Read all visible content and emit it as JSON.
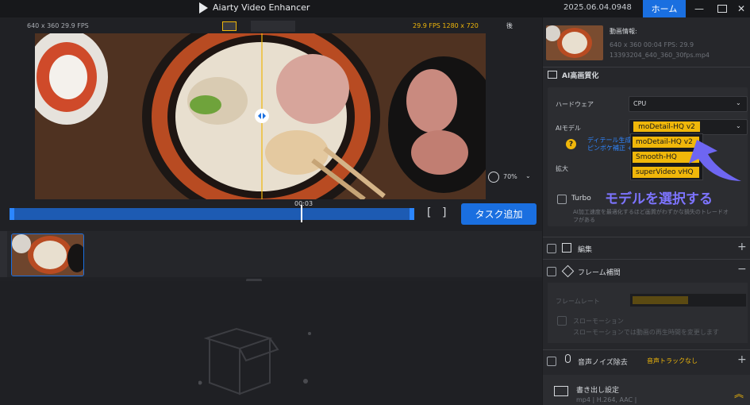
{
  "app": {
    "title": "Aiarty Video Enhancer",
    "date": "2025.06.04.0948",
    "home": "ホーム"
  },
  "video": {
    "src_info": "640 x 360  29.9 FPS",
    "out_info": "29.9 FPS  1280 x 720",
    "after": "後",
    "zoom": "70%",
    "time": "00:03"
  },
  "toolbar": {
    "task_add": "タスク追加"
  },
  "file": {
    "heading": "動画情報:",
    "meta": "640 x 360  00:04    FPS: 29.9",
    "name": "13393204_640_360_30fps.mp4"
  },
  "ai": {
    "title": "AI高画質化",
    "hardware_label": "ハードウェア",
    "hardware_value": "CPU",
    "model_label": "AIモデル",
    "model_value": "moDetail-HQ  v2",
    "detail_line1": "ディテール生成",
    "detail_line2": "ピンボケ補正 +",
    "scale_label": "拡大",
    "menu": [
      "moDetail-HQ  v2",
      "Smooth-HQ",
      "superVideo vHQ"
    ],
    "turbo": "Turbo",
    "turbo_desc_1": "AI加工速度を最適化するほど画質がわずかな損失のトレードオ",
    "turbo_desc_2": "フがある"
  },
  "callout": "モデルを選択する",
  "edit": {
    "label": "編集"
  },
  "frame": {
    "label": "フレーム補間",
    "rate_label": "フレームレート",
    "slow_label": "スローモーション",
    "slow_desc": "スローモーションでは動画の再生時間を変更します"
  },
  "noise": {
    "label": "音声ノイズ除去",
    "value": "音声トラックなし"
  },
  "export": {
    "label": "書き出し設定",
    "format": "mp4 | H.264, AAC |"
  },
  "colors": {
    "accent": "#1a6fe0",
    "highlight": "#f0b70a",
    "callout": "#7d74ff"
  }
}
